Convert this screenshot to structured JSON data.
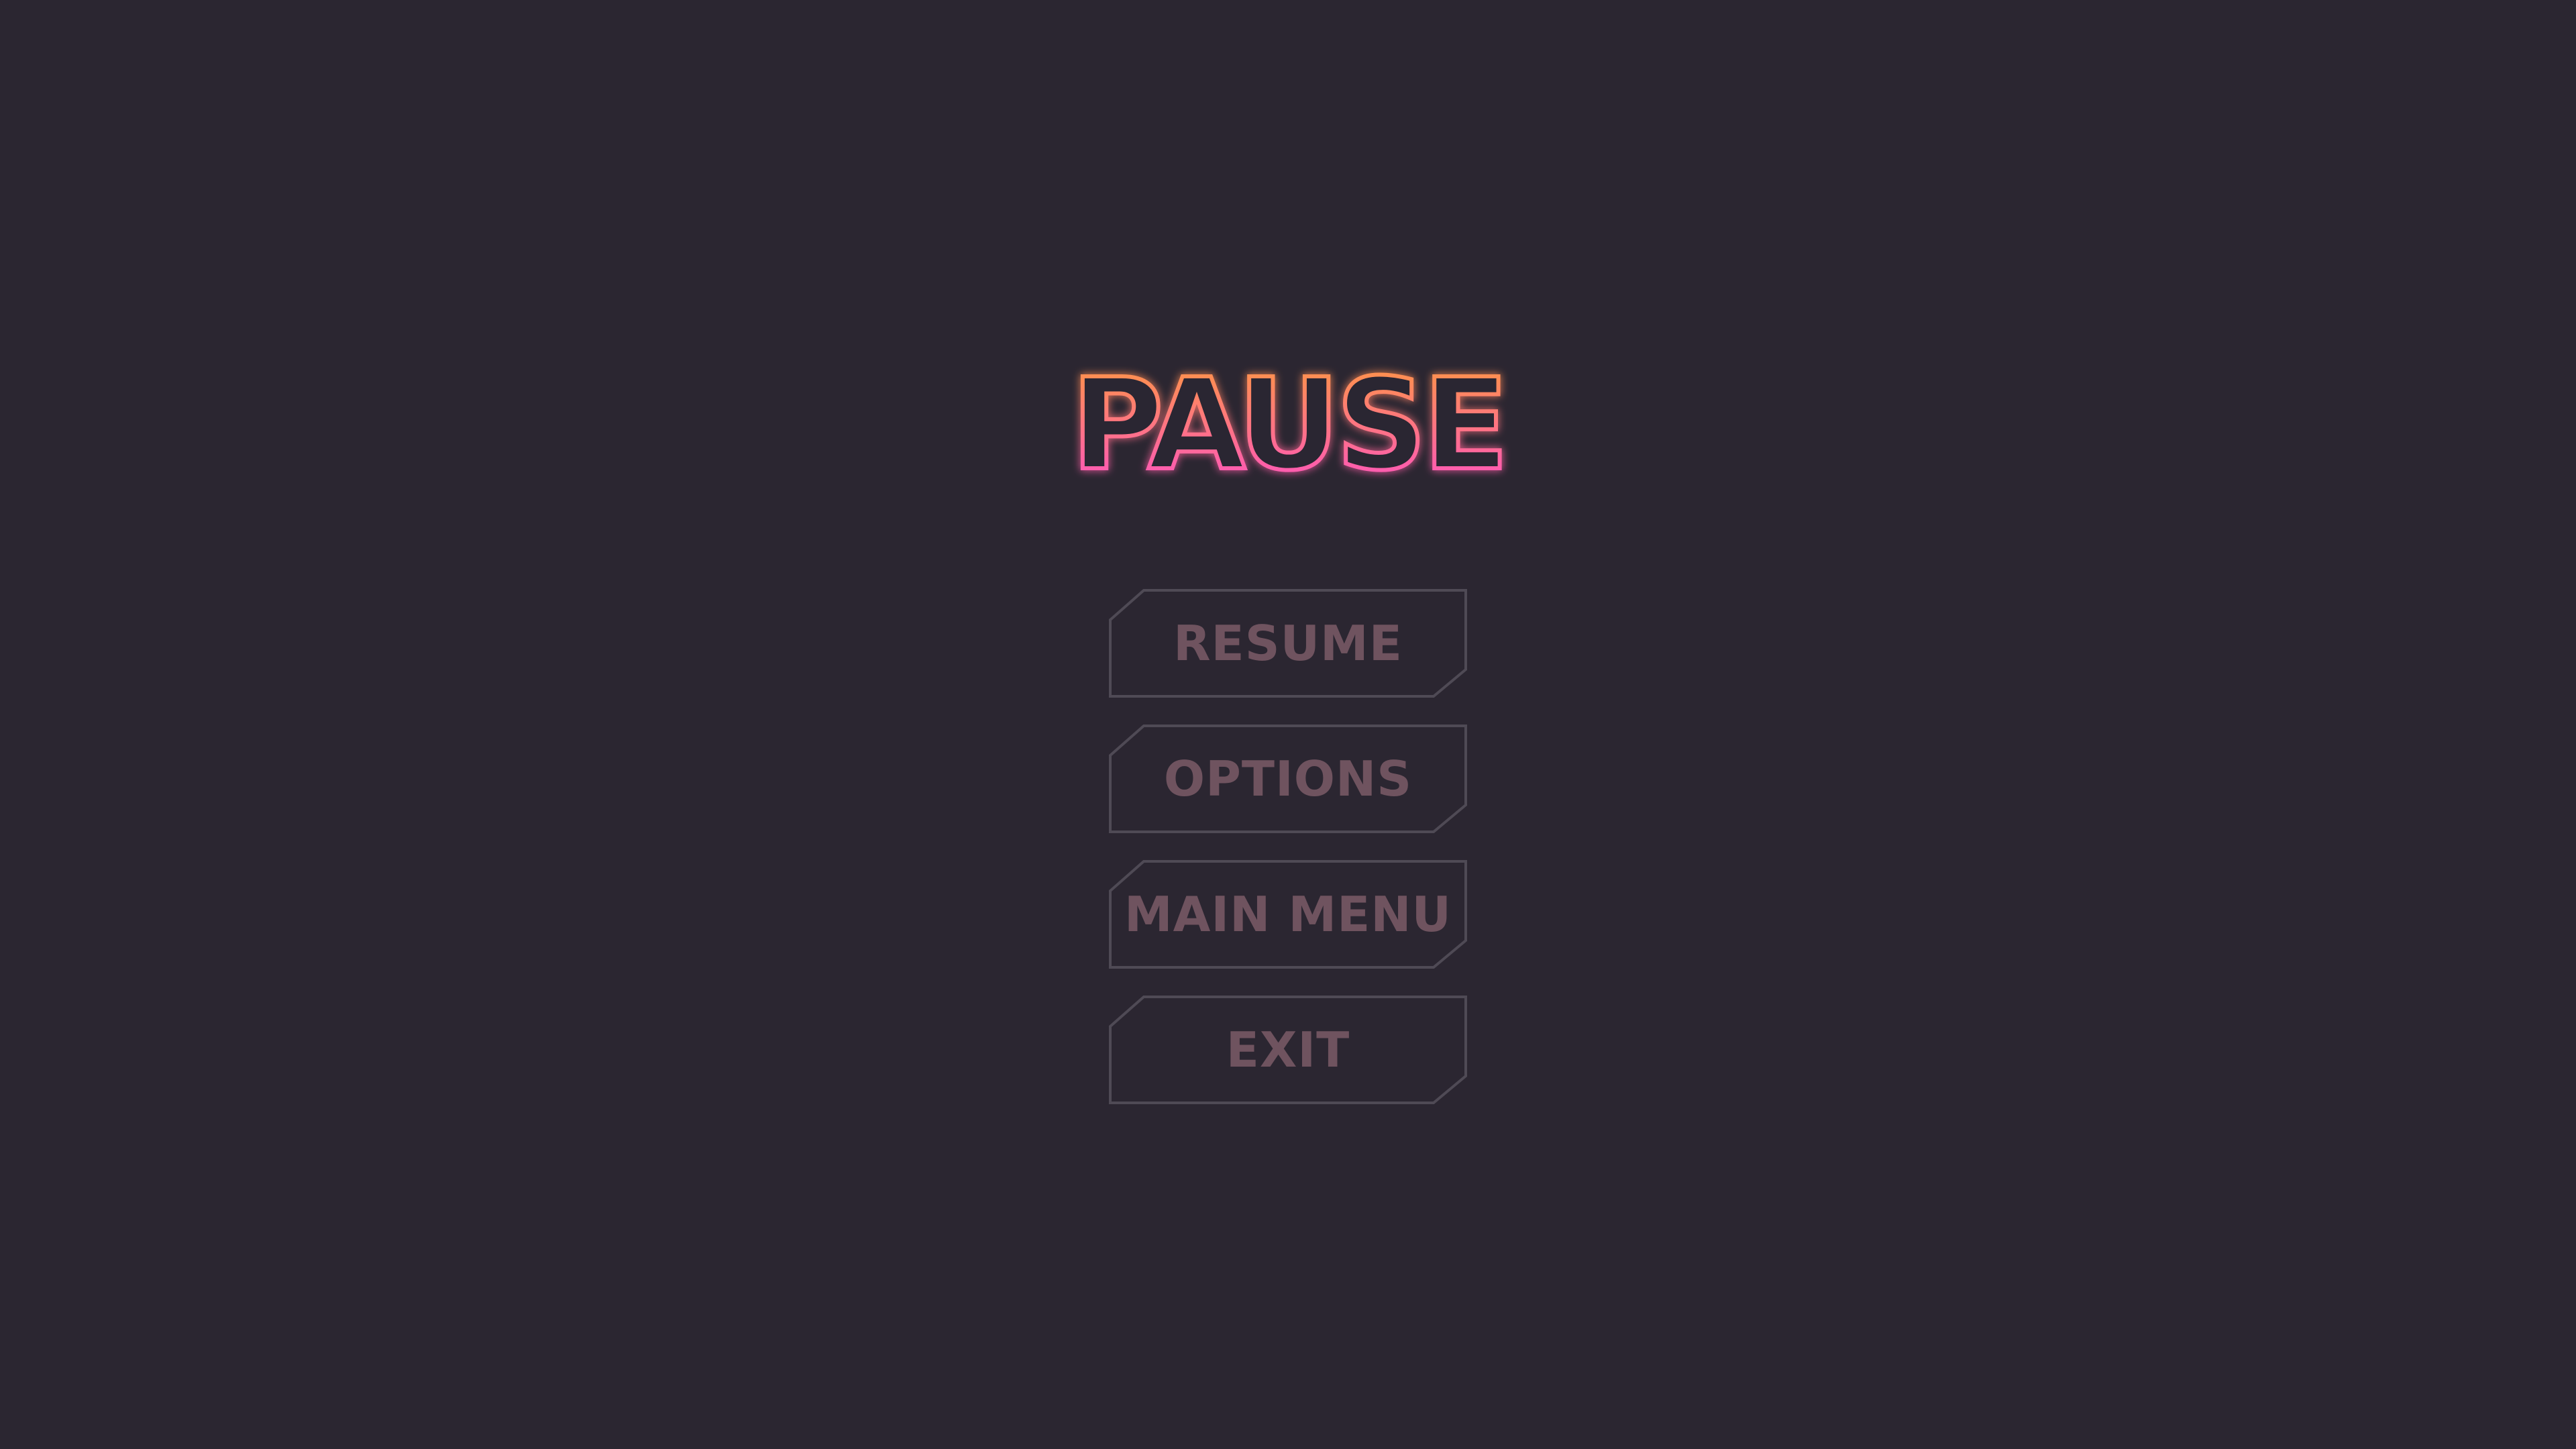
{
  "pause_menu": {
    "title": "PAUSE",
    "title_gradient": {
      "top": "#ff9a3c",
      "bottom": "#ff4fc8"
    },
    "title_fill": "#2b2631",
    "background": "#2b2631",
    "button_border": "#4f4a55",
    "button_text_color": "#6f535f",
    "buttons": [
      {
        "label": "RESUME"
      },
      {
        "label": "OPTIONS"
      },
      {
        "label": "MAIN MENU"
      },
      {
        "label": "EXIT"
      }
    ]
  }
}
